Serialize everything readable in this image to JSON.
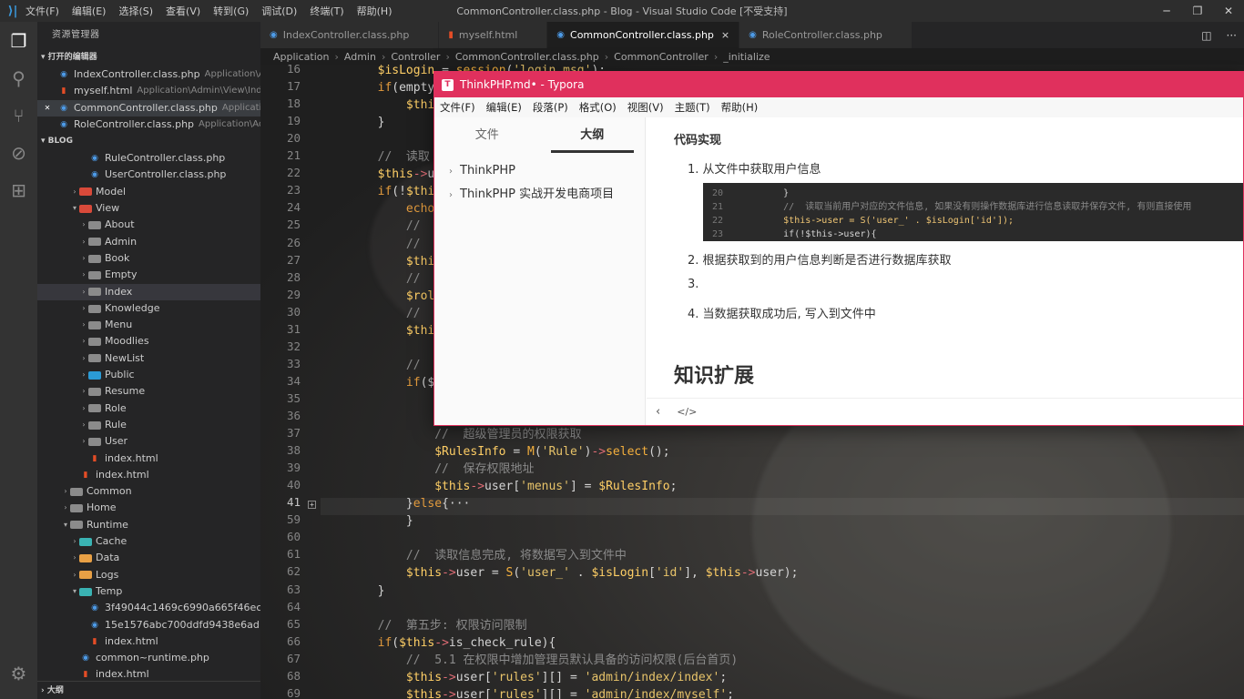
{
  "titlebar": {
    "menus": [
      "文件(F)",
      "编辑(E)",
      "选择(S)",
      "查看(V)",
      "转到(G)",
      "调试(D)",
      "终端(T)",
      "帮助(H)"
    ],
    "title": "CommonController.class.php - Blog - Visual Studio Code [不受支持]"
  },
  "sidebar": {
    "title": "资源管理器",
    "open_editors_label": "打开的编辑器",
    "open_editors": [
      {
        "name": "IndexController.class.php",
        "desc": "Application\\Ad...",
        "type": "php"
      },
      {
        "name": "myself.html",
        "desc": "Application\\Admin\\View\\Index",
        "type": "html"
      },
      {
        "name": "CommonController.class.php",
        "desc": "Applicatio...",
        "type": "php",
        "close": "✕"
      },
      {
        "name": "RoleController.class.php",
        "desc": "Application\\Ad...",
        "type": "php"
      }
    ],
    "project_label": "BLOG",
    "tree": [
      "RuleController.class.php",
      "UserController.class.php",
      "Model",
      "View",
      "About",
      "Admin",
      "Book",
      "Empty",
      "Index",
      "Knowledge",
      "Menu",
      "Moodlies",
      "NewList",
      "Public",
      "Resume",
      "Role",
      "Rule",
      "User",
      "index.html",
      "index.html",
      "Common",
      "Home",
      "Runtime",
      "Cache",
      "Data",
      "Logs",
      "Temp",
      "3f49044c1469c6990a665f46ec6c0...",
      "15e1576abc700ddfd9438e6ad1c8...",
      "index.html",
      "common~runtime.php",
      "index.html"
    ],
    "outline_label": "大纲"
  },
  "tabs": [
    {
      "label": "IndexController.class.php",
      "type": "php"
    },
    {
      "label": "myself.html",
      "type": "html"
    },
    {
      "label": "CommonController.class.php",
      "type": "php",
      "close": "×"
    },
    {
      "label": "RoleController.class.php",
      "type": "php"
    }
  ],
  "breadcrumb": [
    "Application",
    "Admin",
    "Controller",
    "CommonController.class.php",
    "CommonController",
    "_initialize"
  ],
  "editor": {
    "line_numbers": [
      "16",
      "17",
      "18",
      "19",
      "20",
      "21",
      "22",
      "23",
      "24",
      "25",
      "26",
      "27",
      "28",
      "29",
      "30",
      "31",
      "32",
      "33",
      "34",
      "35",
      "36",
      "37",
      "38",
      "39",
      "40",
      "41",
      "59",
      "60",
      "61",
      "62",
      "63",
      "64",
      "65",
      "66",
      "67",
      "68",
      "69"
    ],
    "lines": [
      "        $isLogin = session('login_msg');",
      "        if(empty",
      "            $thi",
      "        }",
      "",
      "        //  读取",
      "        $this->u",
      "        if(!$thi",
      "            echo",
      "            //",
      "            //",
      "            $thi",
      "            //",
      "            $rol",
      "            //",
      "            $thi",
      "",
      "            //",
      "            if($",
      "",
      "",
      "                //  超级管理员的权限获取",
      "                $RulesInfo = M('Rule')->select();",
      "                //  保存权限地址",
      "                $this->user['menus'] = $RulesInfo;",
      "            }else{···",
      "            }",
      "",
      "            //  读取信息完成, 将数据写入到文件中",
      "            $this->user = S('user_' . $isLogin['id'], $this->user);",
      "        }",
      "",
      "        //  第五步: 权限访问限制",
      "        if($this->is_check_rule){",
      "            //  5.1 在权限中增加管理员默认具备的访问权限(后台首页)",
      "            $this->user['rules'][] = 'admin/index/index';",
      "            $this->user['rules'][] = 'admin/index/myself';"
    ]
  },
  "typora": {
    "title": "ThinkPHP.md• - Typora",
    "menus": [
      "文件(F)",
      "编辑(E)",
      "段落(P)",
      "格式(O)",
      "视图(V)",
      "主题(T)",
      "帮助(H)"
    ],
    "tab_files": "文件",
    "tab_outline": "大纲",
    "outline": [
      "ThinkPHP",
      "ThinkPHP 实战开发电商项目"
    ],
    "heading": "代码实现",
    "steps": [
      "1. 从文件中获取用户信息",
      "2. 根据获取到的用户信息判断是否进行数据库获取",
      "3.",
      "4. 当数据获取成功后, 写入到文件中"
    ],
    "snippet": [
      {
        "n": "20",
        "code": "        }"
      },
      {
        "n": "21",
        "code": "        //  读取当前用户对应的文件信息, 如果没有则操作数据库进行信息读取并保存文件, 有则直接使用"
      },
      {
        "n": "22",
        "code": "        $this->user = S('user_' . $isLogin['id']);"
      },
      {
        "n": "23",
        "code": "        if(!$this->user){"
      }
    ],
    "h2": "知识扩展",
    "footer_back": "‹",
    "footer_source": "</>"
  }
}
